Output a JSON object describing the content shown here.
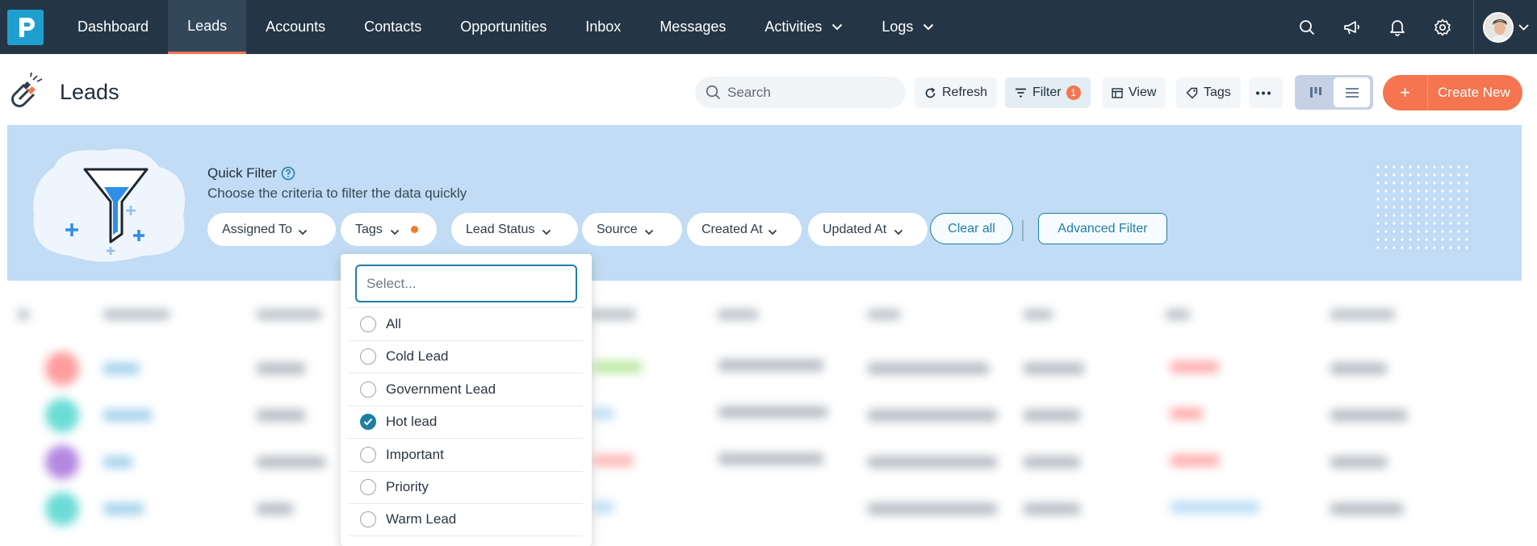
{
  "nav": {
    "logo_letter": "P",
    "items": [
      {
        "label": "Dashboard",
        "active": false,
        "has_dropdown": false
      },
      {
        "label": "Leads",
        "active": true,
        "has_dropdown": false
      },
      {
        "label": "Accounts",
        "active": false,
        "has_dropdown": false
      },
      {
        "label": "Contacts",
        "active": false,
        "has_dropdown": false
      },
      {
        "label": "Opportunities",
        "active": false,
        "has_dropdown": false
      },
      {
        "label": "Inbox",
        "active": false,
        "has_dropdown": false
      },
      {
        "label": "Messages",
        "active": false,
        "has_dropdown": false
      },
      {
        "label": "Activities",
        "active": false,
        "has_dropdown": true
      },
      {
        "label": "Logs",
        "active": false,
        "has_dropdown": true
      }
    ],
    "right_icons": [
      "search-icon",
      "megaphone-icon",
      "bell-icon",
      "gear-icon"
    ]
  },
  "header": {
    "title": "Leads",
    "search_placeholder": "Search",
    "refresh_label": "Refresh",
    "filter_label": "Filter",
    "filter_count": "1",
    "view_label": "View",
    "tags_label": "Tags",
    "create_label": "Create New"
  },
  "quick_filter": {
    "title": "Quick Filter",
    "subtitle": "Choose the criteria to filter the data quickly",
    "pills": [
      {
        "label": "Assigned To"
      },
      {
        "label": "Tags"
      },
      {
        "label": "Lead Status"
      },
      {
        "label": "Source"
      },
      {
        "label": "Created At"
      },
      {
        "label": "Updated At"
      }
    ],
    "clear_label": "Clear all",
    "advanced_label": "Advanced Filter"
  },
  "tags_dropdown": {
    "search_placeholder": "Select...",
    "options": [
      {
        "label": "All",
        "checked": false
      },
      {
        "label": "Cold Lead",
        "checked": false
      },
      {
        "label": "Government Lead",
        "checked": false
      },
      {
        "label": "Hot lead",
        "checked": true
      },
      {
        "label": "Important",
        "checked": false
      },
      {
        "label": "Priority",
        "checked": false
      },
      {
        "label": "Warm Lead",
        "checked": false
      }
    ]
  },
  "colors": {
    "nav_bg": "#243645",
    "accent": "#f47550",
    "teal": "#1f7fa3",
    "panel_bg": "#c1dcf4"
  }
}
